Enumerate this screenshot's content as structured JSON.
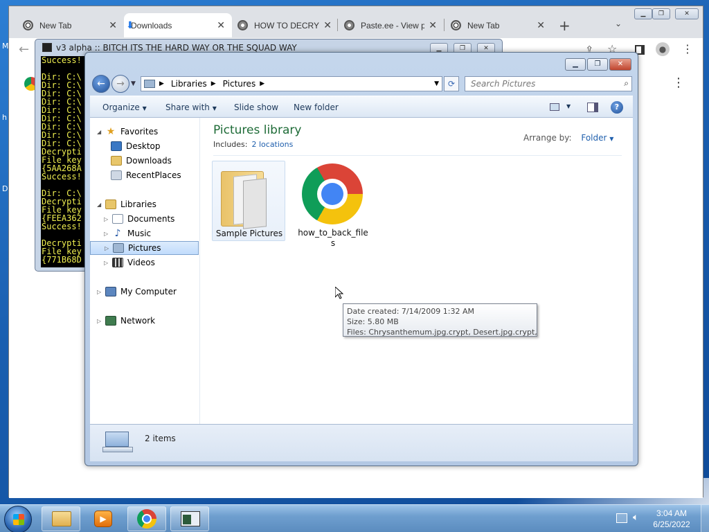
{
  "browser": {
    "tabs": [
      {
        "label": "New Tab",
        "icon": "chrome-icon"
      },
      {
        "label": "Downloads",
        "icon": "download-icon"
      },
      {
        "label": "HOW TO DECRYPT",
        "icon": "globe-icon"
      },
      {
        "label": "Paste.ee - View p",
        "icon": "globe-icon"
      },
      {
        "label": "New Tab",
        "icon": "chrome-icon"
      }
    ],
    "new_tab_glyph": "+"
  },
  "desktop_labels": [
    "M",
    "h",
    "D"
  ],
  "console": {
    "title": "v3 alpha :: BITCH ITS THE HARD WAY OR THE SQUAD WAY",
    "lines": [
      "Success!",
      "",
      "Dir: C:\\",
      "Dir: C:\\",
      "Dir: C:\\",
      "Dir: C:\\",
      "Dir: C:\\",
      "Dir: C:\\",
      "Dir: C:\\",
      "Dir: C:\\",
      "Dir: C:\\",
      "Decrypti",
      "File key",
      "{5AA268A",
      "Success!",
      "",
      "Dir: C:\\",
      "Decrypti",
      "File key",
      "{FEEA362",
      "Success!",
      "",
      "Decrypti",
      "File key",
      "{771B68D"
    ]
  },
  "explorer": {
    "breadcrumbs": [
      "Libraries",
      "Pictures"
    ],
    "search_placeholder": "Search Pictures",
    "commands": [
      "Organize",
      "Share with",
      "Slide show",
      "New folder"
    ],
    "nav": {
      "favorites": "Favorites",
      "favorite_items": [
        "Desktop",
        "Downloads",
        "RecentPlaces"
      ],
      "libraries": "Libraries",
      "library_items": [
        "Documents",
        "Music",
        "Pictures",
        "Videos"
      ],
      "my_computer": "My Computer",
      "network": "Network"
    },
    "library_title": "Pictures library",
    "includes_label": "Includes:",
    "includes_link": "2 locations",
    "arrange_label": "Arrange by:",
    "arrange_value": "Folder",
    "items": [
      {
        "name": "Sample Pictures",
        "icon": "folder-icon"
      },
      {
        "name": "how_to_back_files",
        "icon": "chrome-icon"
      }
    ],
    "tooltip": {
      "date_created": "Date created: 7/14/2009 1:32 AM",
      "size": "Size: 5.80 MB",
      "files": "Files: Chrysanthemum.jpg.crypt, Desert.jpg.crypt, ..."
    },
    "item_count": "2 items"
  },
  "taskbar": {
    "time": "3:04 AM",
    "date": "6/25/2022"
  }
}
